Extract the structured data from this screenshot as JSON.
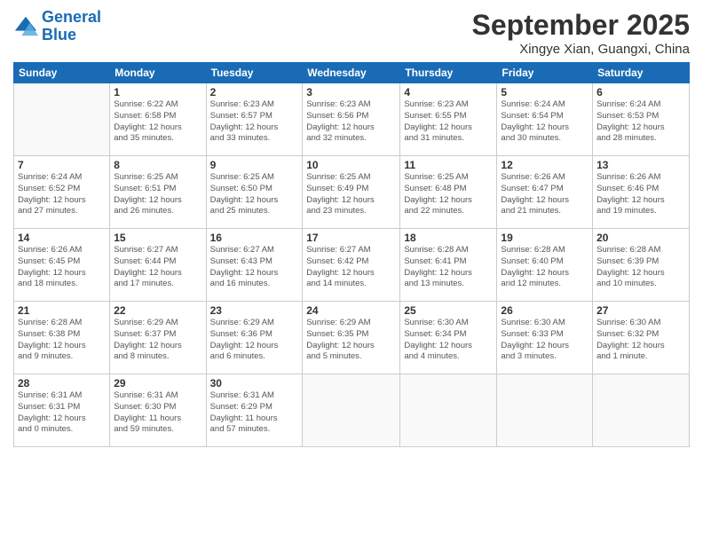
{
  "logo": {
    "line1": "General",
    "line2": "Blue"
  },
  "header": {
    "title": "September 2025",
    "subtitle": "Xingye Xian, Guangxi, China"
  },
  "weekdays": [
    "Sunday",
    "Monday",
    "Tuesday",
    "Wednesday",
    "Thursday",
    "Friday",
    "Saturday"
  ],
  "weeks": [
    [
      {
        "day": "",
        "info": ""
      },
      {
        "day": "1",
        "info": "Sunrise: 6:22 AM\nSunset: 6:58 PM\nDaylight: 12 hours\nand 35 minutes."
      },
      {
        "day": "2",
        "info": "Sunrise: 6:23 AM\nSunset: 6:57 PM\nDaylight: 12 hours\nand 33 minutes."
      },
      {
        "day": "3",
        "info": "Sunrise: 6:23 AM\nSunset: 6:56 PM\nDaylight: 12 hours\nand 32 minutes."
      },
      {
        "day": "4",
        "info": "Sunrise: 6:23 AM\nSunset: 6:55 PM\nDaylight: 12 hours\nand 31 minutes."
      },
      {
        "day": "5",
        "info": "Sunrise: 6:24 AM\nSunset: 6:54 PM\nDaylight: 12 hours\nand 30 minutes."
      },
      {
        "day": "6",
        "info": "Sunrise: 6:24 AM\nSunset: 6:53 PM\nDaylight: 12 hours\nand 28 minutes."
      }
    ],
    [
      {
        "day": "7",
        "info": "Sunrise: 6:24 AM\nSunset: 6:52 PM\nDaylight: 12 hours\nand 27 minutes."
      },
      {
        "day": "8",
        "info": "Sunrise: 6:25 AM\nSunset: 6:51 PM\nDaylight: 12 hours\nand 26 minutes."
      },
      {
        "day": "9",
        "info": "Sunrise: 6:25 AM\nSunset: 6:50 PM\nDaylight: 12 hours\nand 25 minutes."
      },
      {
        "day": "10",
        "info": "Sunrise: 6:25 AM\nSunset: 6:49 PM\nDaylight: 12 hours\nand 23 minutes."
      },
      {
        "day": "11",
        "info": "Sunrise: 6:25 AM\nSunset: 6:48 PM\nDaylight: 12 hours\nand 22 minutes."
      },
      {
        "day": "12",
        "info": "Sunrise: 6:26 AM\nSunset: 6:47 PM\nDaylight: 12 hours\nand 21 minutes."
      },
      {
        "day": "13",
        "info": "Sunrise: 6:26 AM\nSunset: 6:46 PM\nDaylight: 12 hours\nand 19 minutes."
      }
    ],
    [
      {
        "day": "14",
        "info": "Sunrise: 6:26 AM\nSunset: 6:45 PM\nDaylight: 12 hours\nand 18 minutes."
      },
      {
        "day": "15",
        "info": "Sunrise: 6:27 AM\nSunset: 6:44 PM\nDaylight: 12 hours\nand 17 minutes."
      },
      {
        "day": "16",
        "info": "Sunrise: 6:27 AM\nSunset: 6:43 PM\nDaylight: 12 hours\nand 16 minutes."
      },
      {
        "day": "17",
        "info": "Sunrise: 6:27 AM\nSunset: 6:42 PM\nDaylight: 12 hours\nand 14 minutes."
      },
      {
        "day": "18",
        "info": "Sunrise: 6:28 AM\nSunset: 6:41 PM\nDaylight: 12 hours\nand 13 minutes."
      },
      {
        "day": "19",
        "info": "Sunrise: 6:28 AM\nSunset: 6:40 PM\nDaylight: 12 hours\nand 12 minutes."
      },
      {
        "day": "20",
        "info": "Sunrise: 6:28 AM\nSunset: 6:39 PM\nDaylight: 12 hours\nand 10 minutes."
      }
    ],
    [
      {
        "day": "21",
        "info": "Sunrise: 6:28 AM\nSunset: 6:38 PM\nDaylight: 12 hours\nand 9 minutes."
      },
      {
        "day": "22",
        "info": "Sunrise: 6:29 AM\nSunset: 6:37 PM\nDaylight: 12 hours\nand 8 minutes."
      },
      {
        "day": "23",
        "info": "Sunrise: 6:29 AM\nSunset: 6:36 PM\nDaylight: 12 hours\nand 6 minutes."
      },
      {
        "day": "24",
        "info": "Sunrise: 6:29 AM\nSunset: 6:35 PM\nDaylight: 12 hours\nand 5 minutes."
      },
      {
        "day": "25",
        "info": "Sunrise: 6:30 AM\nSunset: 6:34 PM\nDaylight: 12 hours\nand 4 minutes."
      },
      {
        "day": "26",
        "info": "Sunrise: 6:30 AM\nSunset: 6:33 PM\nDaylight: 12 hours\nand 3 minutes."
      },
      {
        "day": "27",
        "info": "Sunrise: 6:30 AM\nSunset: 6:32 PM\nDaylight: 12 hours\nand 1 minute."
      }
    ],
    [
      {
        "day": "28",
        "info": "Sunrise: 6:31 AM\nSunset: 6:31 PM\nDaylight: 12 hours\nand 0 minutes."
      },
      {
        "day": "29",
        "info": "Sunrise: 6:31 AM\nSunset: 6:30 PM\nDaylight: 11 hours\nand 59 minutes."
      },
      {
        "day": "30",
        "info": "Sunrise: 6:31 AM\nSunset: 6:29 PM\nDaylight: 11 hours\nand 57 minutes."
      },
      {
        "day": "",
        "info": ""
      },
      {
        "day": "",
        "info": ""
      },
      {
        "day": "",
        "info": ""
      },
      {
        "day": "",
        "info": ""
      }
    ]
  ]
}
